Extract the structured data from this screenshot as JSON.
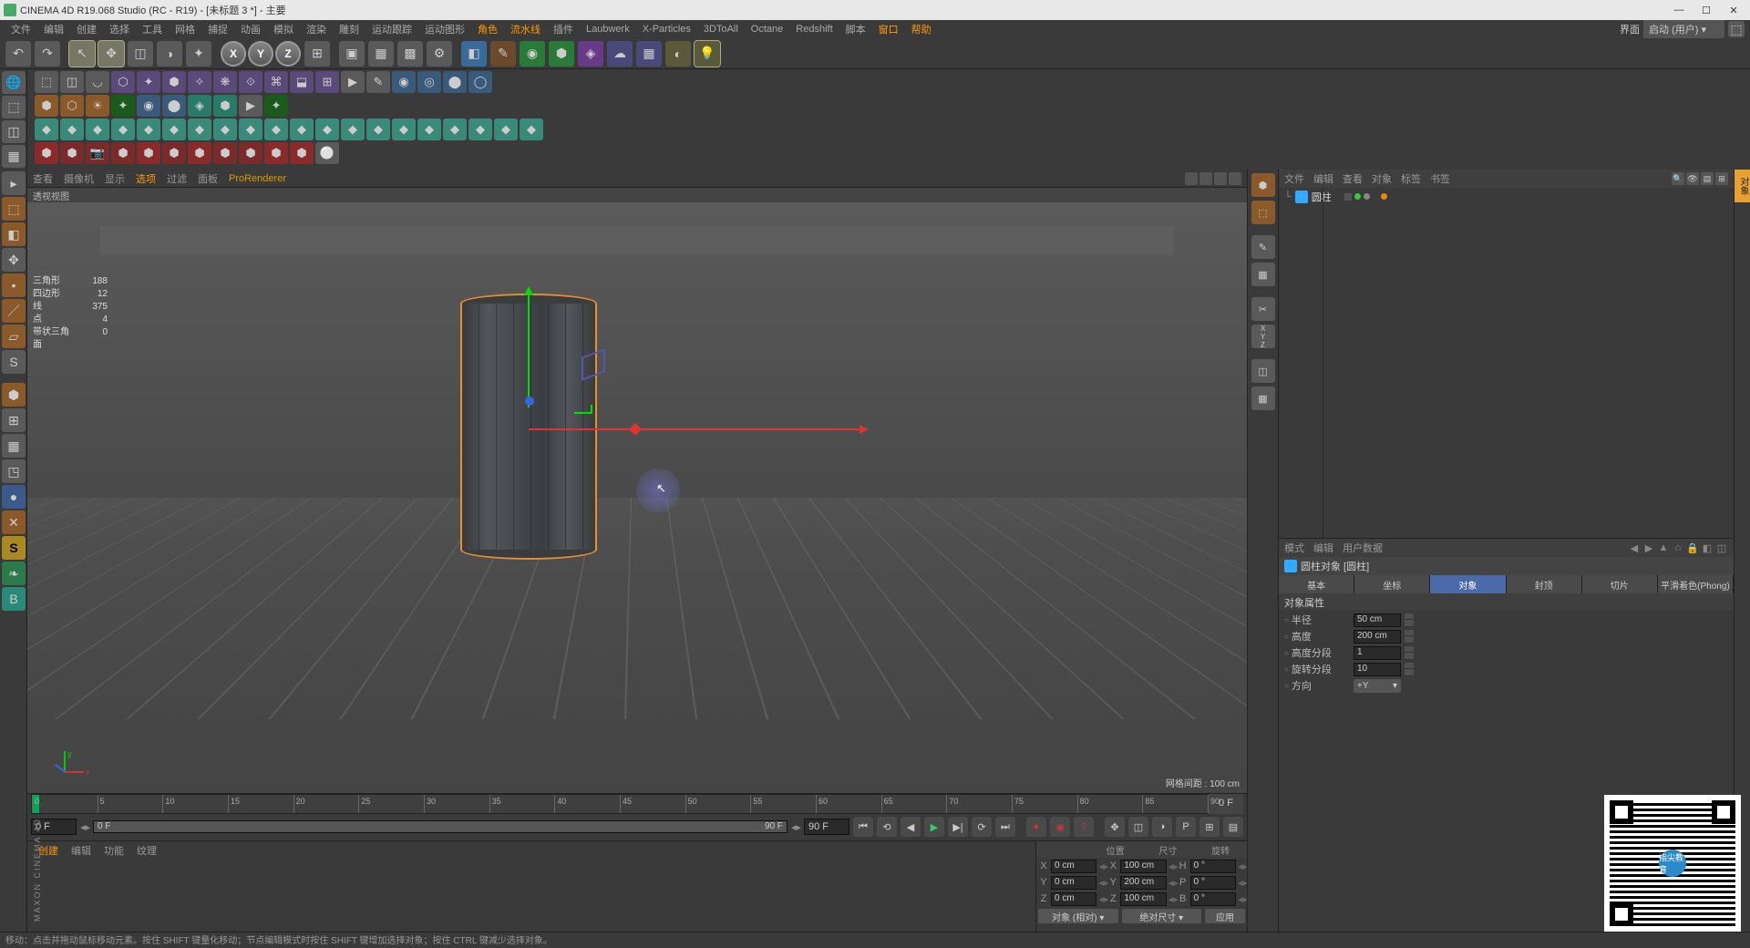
{
  "window": {
    "title": "CINEMA 4D R19.068 Studio (RC - R19) - [未标题 3 *] - 主要",
    "layout_label": "界面",
    "layout_value": "启动 (用户)"
  },
  "menu": [
    "文件",
    "编辑",
    "创建",
    "选择",
    "工具",
    "网格",
    "捕捉",
    "动画",
    "模拟",
    "渲染",
    "雕刻",
    "运动跟踪",
    "运动图形",
    "角色",
    "流水线",
    "插件",
    "Laubwerk",
    "X-Particles",
    "3DToAll",
    "Octane",
    "Redshift",
    "脚本",
    "窗口",
    "帮助"
  ],
  "menu_highlight": [
    "角色",
    "流水线",
    "窗口",
    "帮助"
  ],
  "viewport_menu": [
    "查看",
    "摄像机",
    "显示",
    "选项",
    "过滤",
    "面板",
    "ProRenderer"
  ],
  "viewport_menu_hl": [
    "选项"
  ],
  "viewport_menu_last": "ProRenderer",
  "viewport": {
    "label": "透视视图",
    "grid_label": "网格间距 : 100 cm",
    "stats": [
      {
        "label": "三角形",
        "value": "188"
      },
      {
        "label": "四边形",
        "value": "12"
      },
      {
        "label": "线",
        "value": "375"
      },
      {
        "label": "点",
        "value": "4"
      },
      {
        "label": "带状三角面",
        "value": "0"
      }
    ]
  },
  "timeline": {
    "ticks": [
      "0",
      "5",
      "10",
      "15",
      "20",
      "25",
      "30",
      "35",
      "40",
      "45",
      "50",
      "55",
      "60",
      "65",
      "70",
      "75",
      "80",
      "85",
      "90"
    ],
    "end_label": "0 F",
    "start_field": "0 F",
    "range_start": "0 F",
    "range_end": "90 F",
    "end_field": "90 F"
  },
  "lower_menu": [
    "创建",
    "编辑",
    "功能",
    "纹理"
  ],
  "lower_menu_hl": [
    "创建"
  ],
  "coords_panel": {
    "headers": [
      "位置",
      "尺寸",
      "旋转"
    ],
    "rows": [
      {
        "axis": "X",
        "pos": "0 cm",
        "size_axis": "X",
        "size": "100 cm",
        "rot_axis": "H",
        "rot": "0 °"
      },
      {
        "axis": "Y",
        "pos": "0 cm",
        "size_axis": "Y",
        "size": "200 cm",
        "rot_axis": "P",
        "rot": "0 °"
      },
      {
        "axis": "Z",
        "pos": "0 cm",
        "size_axis": "Z",
        "size": "100 cm",
        "rot_axis": "B",
        "rot": "0 °"
      }
    ],
    "dd1": "对象 (相对)",
    "dd2": "绝对尺寸",
    "apply": "应用"
  },
  "obj_manager": {
    "menu": [
      "文件",
      "编辑",
      "查看",
      "对象",
      "标签",
      "书签"
    ],
    "object_name": "圆柱"
  },
  "attributes": {
    "menu": [
      "模式",
      "编辑",
      "用户数据"
    ],
    "title": "圆柱对象 [圆柱]",
    "tabs": [
      "基本",
      "坐标",
      "对象",
      "封顶",
      "切片",
      "平滑着色(Phong)"
    ],
    "active_tab": "对象",
    "section": "对象属性",
    "rows": [
      {
        "label": "半径",
        "value": "50 cm",
        "type": "num"
      },
      {
        "label": "高度",
        "value": "200 cm",
        "type": "num"
      },
      {
        "label": "高度分段",
        "value": "1",
        "type": "num"
      },
      {
        "label": "旋转分段",
        "value": "10",
        "type": "num"
      },
      {
        "label": "方向",
        "value": "+Y",
        "type": "dd"
      }
    ]
  },
  "status": "移动：点击并拖动鼠标移动元素。按住 SHIFT 键量化移动；节点编辑模式时按住 SHIFT 键增加选择对象；按住 CTRL 键减少选择对象。",
  "qr_label": "指尖教育",
  "logo": "MAXON  CINEMA 4D"
}
